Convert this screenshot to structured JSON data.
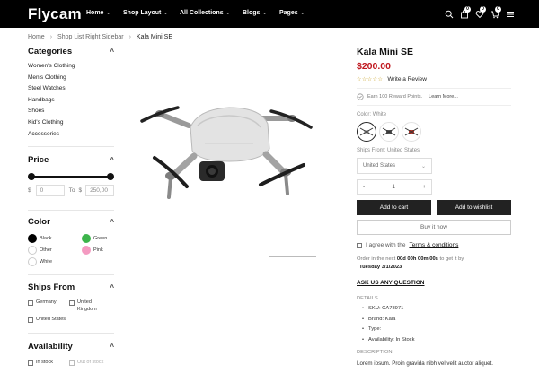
{
  "header": {
    "logo": "Flycam",
    "nav": [
      {
        "label": "Home"
      },
      {
        "label": "Shop Layout"
      },
      {
        "label": "All Collections"
      },
      {
        "label": "Blogs"
      },
      {
        "label": "Pages"
      }
    ],
    "badges": {
      "account": "0",
      "wishlist": "0",
      "cart": "0"
    }
  },
  "breadcrumb": [
    "Home",
    "Shop List Right Sidebar",
    "Kala Mini SE"
  ],
  "sidebar": {
    "categories": {
      "title": "Categories",
      "toggle": "^",
      "items": [
        "Women's Clothing",
        "Men's Clothing",
        "Steel Watches",
        "Handbags",
        "Shoes",
        "Kid's Clothing",
        "Accessories"
      ]
    },
    "price": {
      "title": "Price",
      "toggle": "^",
      "currency": "$",
      "min": "0",
      "to_label": "To",
      "max": "250,00"
    },
    "color": {
      "title": "Color",
      "toggle": "^",
      "options": [
        {
          "label": "Black",
          "color": "#000000"
        },
        {
          "label": "Green",
          "color": "#3cb44b"
        },
        {
          "label": "Other",
          "color": "#ffffff"
        },
        {
          "label": "Pink",
          "color": "#f49ac1"
        },
        {
          "label": "White",
          "color": "#ffffff"
        }
      ]
    },
    "ships": {
      "title": "Ships From",
      "toggle": "^",
      "options": [
        "Germany",
        "United Kingdom",
        "United States"
      ]
    },
    "availability": {
      "title": "Availability",
      "toggle": "^",
      "options": [
        "In stock",
        "Out of stock"
      ]
    }
  },
  "product": {
    "title": "Kala Mini SE",
    "price": "$200.00",
    "stars": "☆☆☆☆☆",
    "write_review": "Write a Review",
    "reward": "Earn 100 Reward Points.",
    "learn_more": "Learn More...",
    "color_label": "Color:",
    "color_value": "White",
    "ships_label": "Ships From:",
    "ships_value": "United States",
    "ships_select": "United States",
    "qty_minus": "-",
    "qty": "1",
    "qty_plus": "+",
    "add_to_cart": "Add to cart",
    "add_to_wishlist": "Add to wishlist",
    "buy_now": "Buy it now",
    "agree_text": "I agree with the",
    "terms": "Terms & conditions",
    "order_prefix": "Order in the next",
    "order_countdown": "00d 00h 00m 00s",
    "order_suffix": "to get it by",
    "order_date": "Tuesday 3/1/2023",
    "ask": "ASK US ANY QUESTION",
    "details_title": "DETAILS",
    "details": [
      "SKU: CA78971",
      "Brand: Kala",
      "Type:",
      "Availability: In Stock"
    ],
    "description_title": "DESCRIPTION",
    "description": "Lorem ipsum. Proin gravida nibh vel velit auctor aliquet."
  }
}
